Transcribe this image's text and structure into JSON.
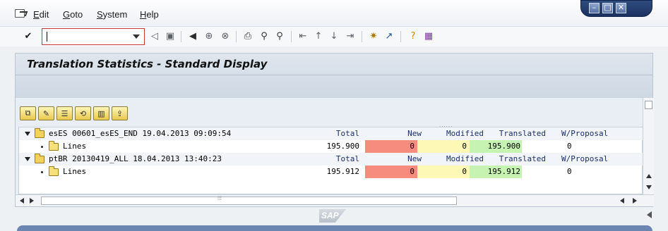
{
  "menu": {
    "items": [
      {
        "label": "Edit",
        "u": "E",
        "rest": "dit"
      },
      {
        "label": "Goto",
        "u": "G",
        "rest": "oto"
      },
      {
        "label": "System",
        "u": "S",
        "rest": "ystem"
      },
      {
        "label": "Help",
        "u": "H",
        "rest": "elp"
      }
    ]
  },
  "window": {
    "minimize": "–",
    "maximize": "□",
    "close": "✕"
  },
  "toolbar": {
    "command_field_value": "",
    "icons": [
      "enter-icon",
      "back-icon",
      "save-icon",
      "back-green-icon",
      "exit-icon",
      "cancel-icon",
      "print-icon",
      "find-icon",
      "find-next-icon",
      "first-page-icon",
      "previous-page-icon",
      "next-page-icon",
      "last-page-icon",
      "create-session-icon",
      "shortcut-icon",
      "help-icon",
      "customize-layout-icon"
    ]
  },
  "title": "Translation Statistics - Standard Display",
  "alv_toolbar": {
    "icons": [
      "details-icon",
      "edit-icon",
      "list-icon",
      "change-layout-icon",
      "chart-icon",
      "export-icon"
    ]
  },
  "tree": {
    "nodes": [
      {
        "label": "esES 00601_esES_END 19.04.2013 09:09:54",
        "headers": {
          "total": "Total",
          "new": "New",
          "modified": "Modified",
          "translated": "Translated",
          "proposal": "W/Proposal"
        },
        "child": {
          "label": "Lines",
          "total": "195.900",
          "new": "0",
          "modified": "0",
          "translated": "195.900",
          "proposal": "0"
        }
      },
      {
        "label": "ptBR 20130419_ALL 18.04.2013 13:40:23",
        "headers": {
          "total": "Total",
          "new": "New",
          "modified": "Modified",
          "translated": "Translated",
          "proposal": "W/Proposal"
        },
        "child": {
          "label": "Lines",
          "total": "195.912",
          "new": "0",
          "modified": "0",
          "translated": "195.912",
          "proposal": "0"
        }
      }
    ]
  },
  "footer": {
    "logo": "SAP"
  },
  "colors": {
    "new": "#f68c7e",
    "modified": "#fdf8b6",
    "translated": "#c6f2b2",
    "accent": "#1b3160"
  }
}
